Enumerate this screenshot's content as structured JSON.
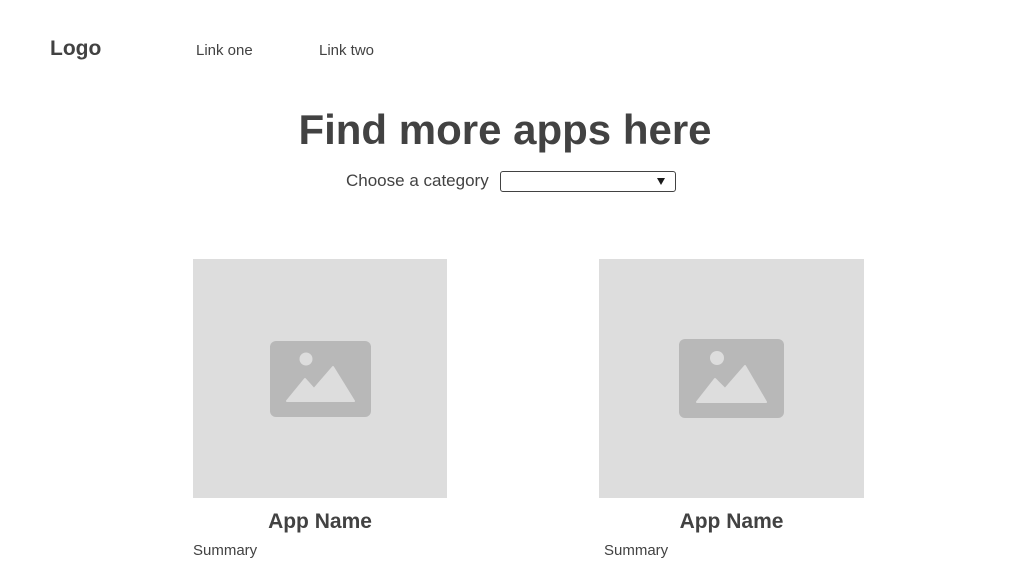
{
  "header": {
    "logo": "Logo",
    "links": [
      "Link one",
      "Link two"
    ]
  },
  "hero": {
    "title": "Find more apps here",
    "category_label": "Choose a category",
    "category_value": ""
  },
  "apps": [
    {
      "name": "App Name",
      "summary": "Summary",
      "image_icon": "image-placeholder-icon"
    },
    {
      "name": "App Name",
      "summary": "Summary",
      "image_icon": "image-placeholder-icon"
    }
  ],
  "colors": {
    "text": "#424242",
    "placeholder_bg": "#dddddd",
    "placeholder_icon": "#b8b8b8",
    "placeholder_icon_detail": "#dddddd"
  }
}
